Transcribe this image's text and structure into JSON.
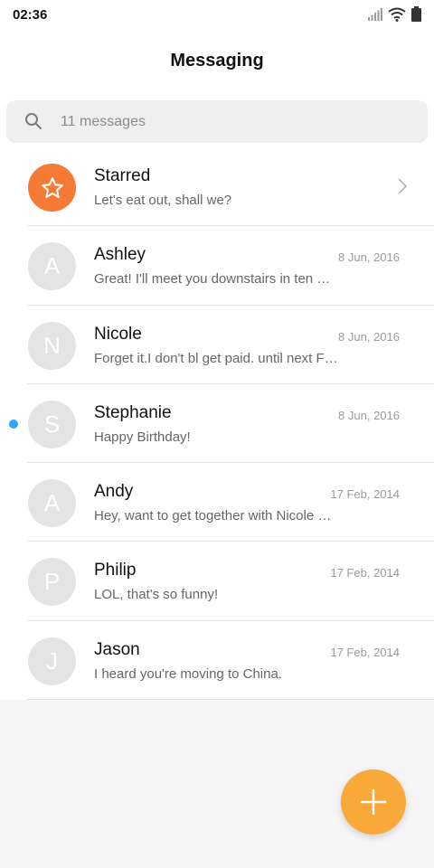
{
  "status_bar": {
    "time": "02:36"
  },
  "header": {
    "title": "Messaging"
  },
  "search": {
    "placeholder": "11 messages"
  },
  "colors": {
    "accent": "#f8a93a",
    "starred": "#f47a35",
    "unread": "#2ea6f5"
  },
  "starred": {
    "name": "Starred",
    "preview": "Let's eat out, shall we?",
    "icon": "star-icon"
  },
  "conversations": [
    {
      "initial": "A",
      "name": "Ashley",
      "preview": "Great! I'll meet you downstairs in ten …",
      "date": "8 Jun, 2016",
      "unread": false
    },
    {
      "initial": "N",
      "name": "Nicole",
      "preview": "Forget it.I don't bl get paid. until next F…",
      "date": "8 Jun, 2016",
      "unread": false
    },
    {
      "initial": "S",
      "name": "Stephanie",
      "preview": "Happy Birthday!",
      "date": "8 Jun, 2016",
      "unread": true
    },
    {
      "initial": "A",
      "name": "Andy",
      "preview": "Hey, want to get together with Nicole …",
      "date": "17 Feb, 2014",
      "unread": false
    },
    {
      "initial": "P",
      "name": "Philip",
      "preview": "LOL, that's so funny!",
      "date": "17 Feb, 2014",
      "unread": false
    },
    {
      "initial": "J",
      "name": "Jason",
      "preview": "I heard you're moving to China.",
      "date": "17 Feb, 2014",
      "unread": false
    }
  ],
  "fab": {
    "icon": "plus-icon"
  }
}
